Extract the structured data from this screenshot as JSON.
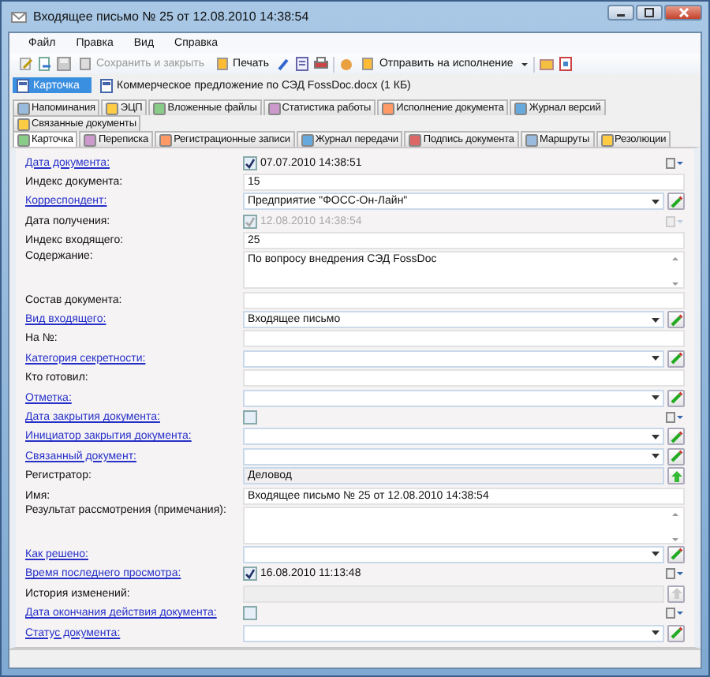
{
  "window": {
    "title": "Входящее письмо № 25 от 12.08.2010 14:38:54"
  },
  "menu": [
    "Файл",
    "Правка",
    "Вид",
    "Справка"
  ],
  "toolbar": [
    {
      "label": "Сохранить и закрыть",
      "disabled": true
    },
    {
      "label": "Печать",
      "disabled": false
    },
    {
      "label": "Отправить на исполнение",
      "disabled": false
    }
  ],
  "attachments": [
    {
      "label": "Карточка",
      "selected": true
    },
    {
      "label": "Коммерческое предложение по СЭД FossDoc.docx (1 КБ)",
      "selected": false
    }
  ],
  "tab_rows": [
    [
      {
        "label": "Напоминания",
        "selected": false
      },
      {
        "label": "ЭЦП",
        "selected": false
      },
      {
        "label": "Вложенные файлы",
        "selected": false
      },
      {
        "label": "Статистика работы",
        "selected": false
      },
      {
        "label": "Исполнение документа",
        "selected": false
      },
      {
        "label": "Журнал версий",
        "selected": false
      }
    ],
    [
      {
        "label": "Связанные документы",
        "selected": false
      }
    ],
    [
      {
        "label": "Карточка",
        "selected": true
      },
      {
        "label": "Переписка",
        "selected": false
      },
      {
        "label": "Регистрационные записи",
        "selected": false
      },
      {
        "label": "Журнал передачи",
        "selected": false
      },
      {
        "label": "Подпись документа",
        "selected": false
      },
      {
        "label": "Маршруты",
        "selected": false
      },
      {
        "label": "Резолюции",
        "selected": false
      }
    ]
  ],
  "fields": [
    {
      "label": "Дата документа:",
      "link": true,
      "kind": "date",
      "value": "07.07.2010 14:38:51",
      "checked": true,
      "disabled": false
    },
    {
      "label": "Индекс документа:",
      "link": false,
      "kind": "text",
      "value": "15"
    },
    {
      "label": "Корреспондент:",
      "link": true,
      "kind": "combo",
      "value": "Предприятие \"ФОСС-Он-Лайн\""
    },
    {
      "label": "Дата получения:",
      "link": false,
      "kind": "date",
      "value": "12.08.2010 14:38:54",
      "checked": true,
      "disabled": true
    },
    {
      "label": "Индекс входящего:",
      "link": false,
      "kind": "text",
      "value": "25"
    },
    {
      "label": "Содержание:",
      "link": false,
      "kind": "memo",
      "value": "По вопросу внедрения СЭД FossDoc"
    },
    {
      "label": "Состав документа:",
      "link": false,
      "kind": "text"
    },
    {
      "label": "Вид входящего:",
      "link": true,
      "kind": "combo",
      "value": "Входящее письмо"
    },
    {
      "label": "На №:",
      "link": false,
      "kind": "text"
    },
    {
      "label": "Категория секретности:",
      "link": true,
      "kind": "combo"
    },
    {
      "label": "Кто готовил:",
      "link": false,
      "kind": "text"
    },
    {
      "label": "Отметка:",
      "link": true,
      "kind": "combo"
    },
    {
      "label": "Дата закрытия документа:",
      "link": true,
      "kind": "date",
      "checked": false,
      "disabled": false
    },
    {
      "label": "Инициатор закрытия документа:",
      "link": true,
      "kind": "combo"
    },
    {
      "label": "Связанный документ:",
      "link": true,
      "kind": "combo"
    },
    {
      "label": "Регистратор:",
      "link": false,
      "kind": "lookup",
      "value": "Деловод",
      "disabled": false
    },
    {
      "label": "Имя:",
      "link": false,
      "kind": "text",
      "value": "Входящее письмо № 25 от 12.08.2010 14:38:54"
    },
    {
      "label": "Результат рассмотрения (примечания):",
      "link": false,
      "kind": "memo"
    },
    {
      "label": "Как решено:",
      "link": true,
      "kind": "combo"
    },
    {
      "label": "Время последнего просмотра:",
      "link": true,
      "kind": "date",
      "value": "16.08.2010 11:13:48",
      "checked": true,
      "disabled": false
    },
    {
      "label": "История изменений:",
      "link": false,
      "kind": "lookup",
      "disabled": true
    },
    {
      "label": "Дата окончания действия документа:",
      "link": true,
      "kind": "date",
      "checked": false,
      "disabled": false
    },
    {
      "label": "Статус документа:",
      "link": true,
      "kind": "combo"
    }
  ]
}
